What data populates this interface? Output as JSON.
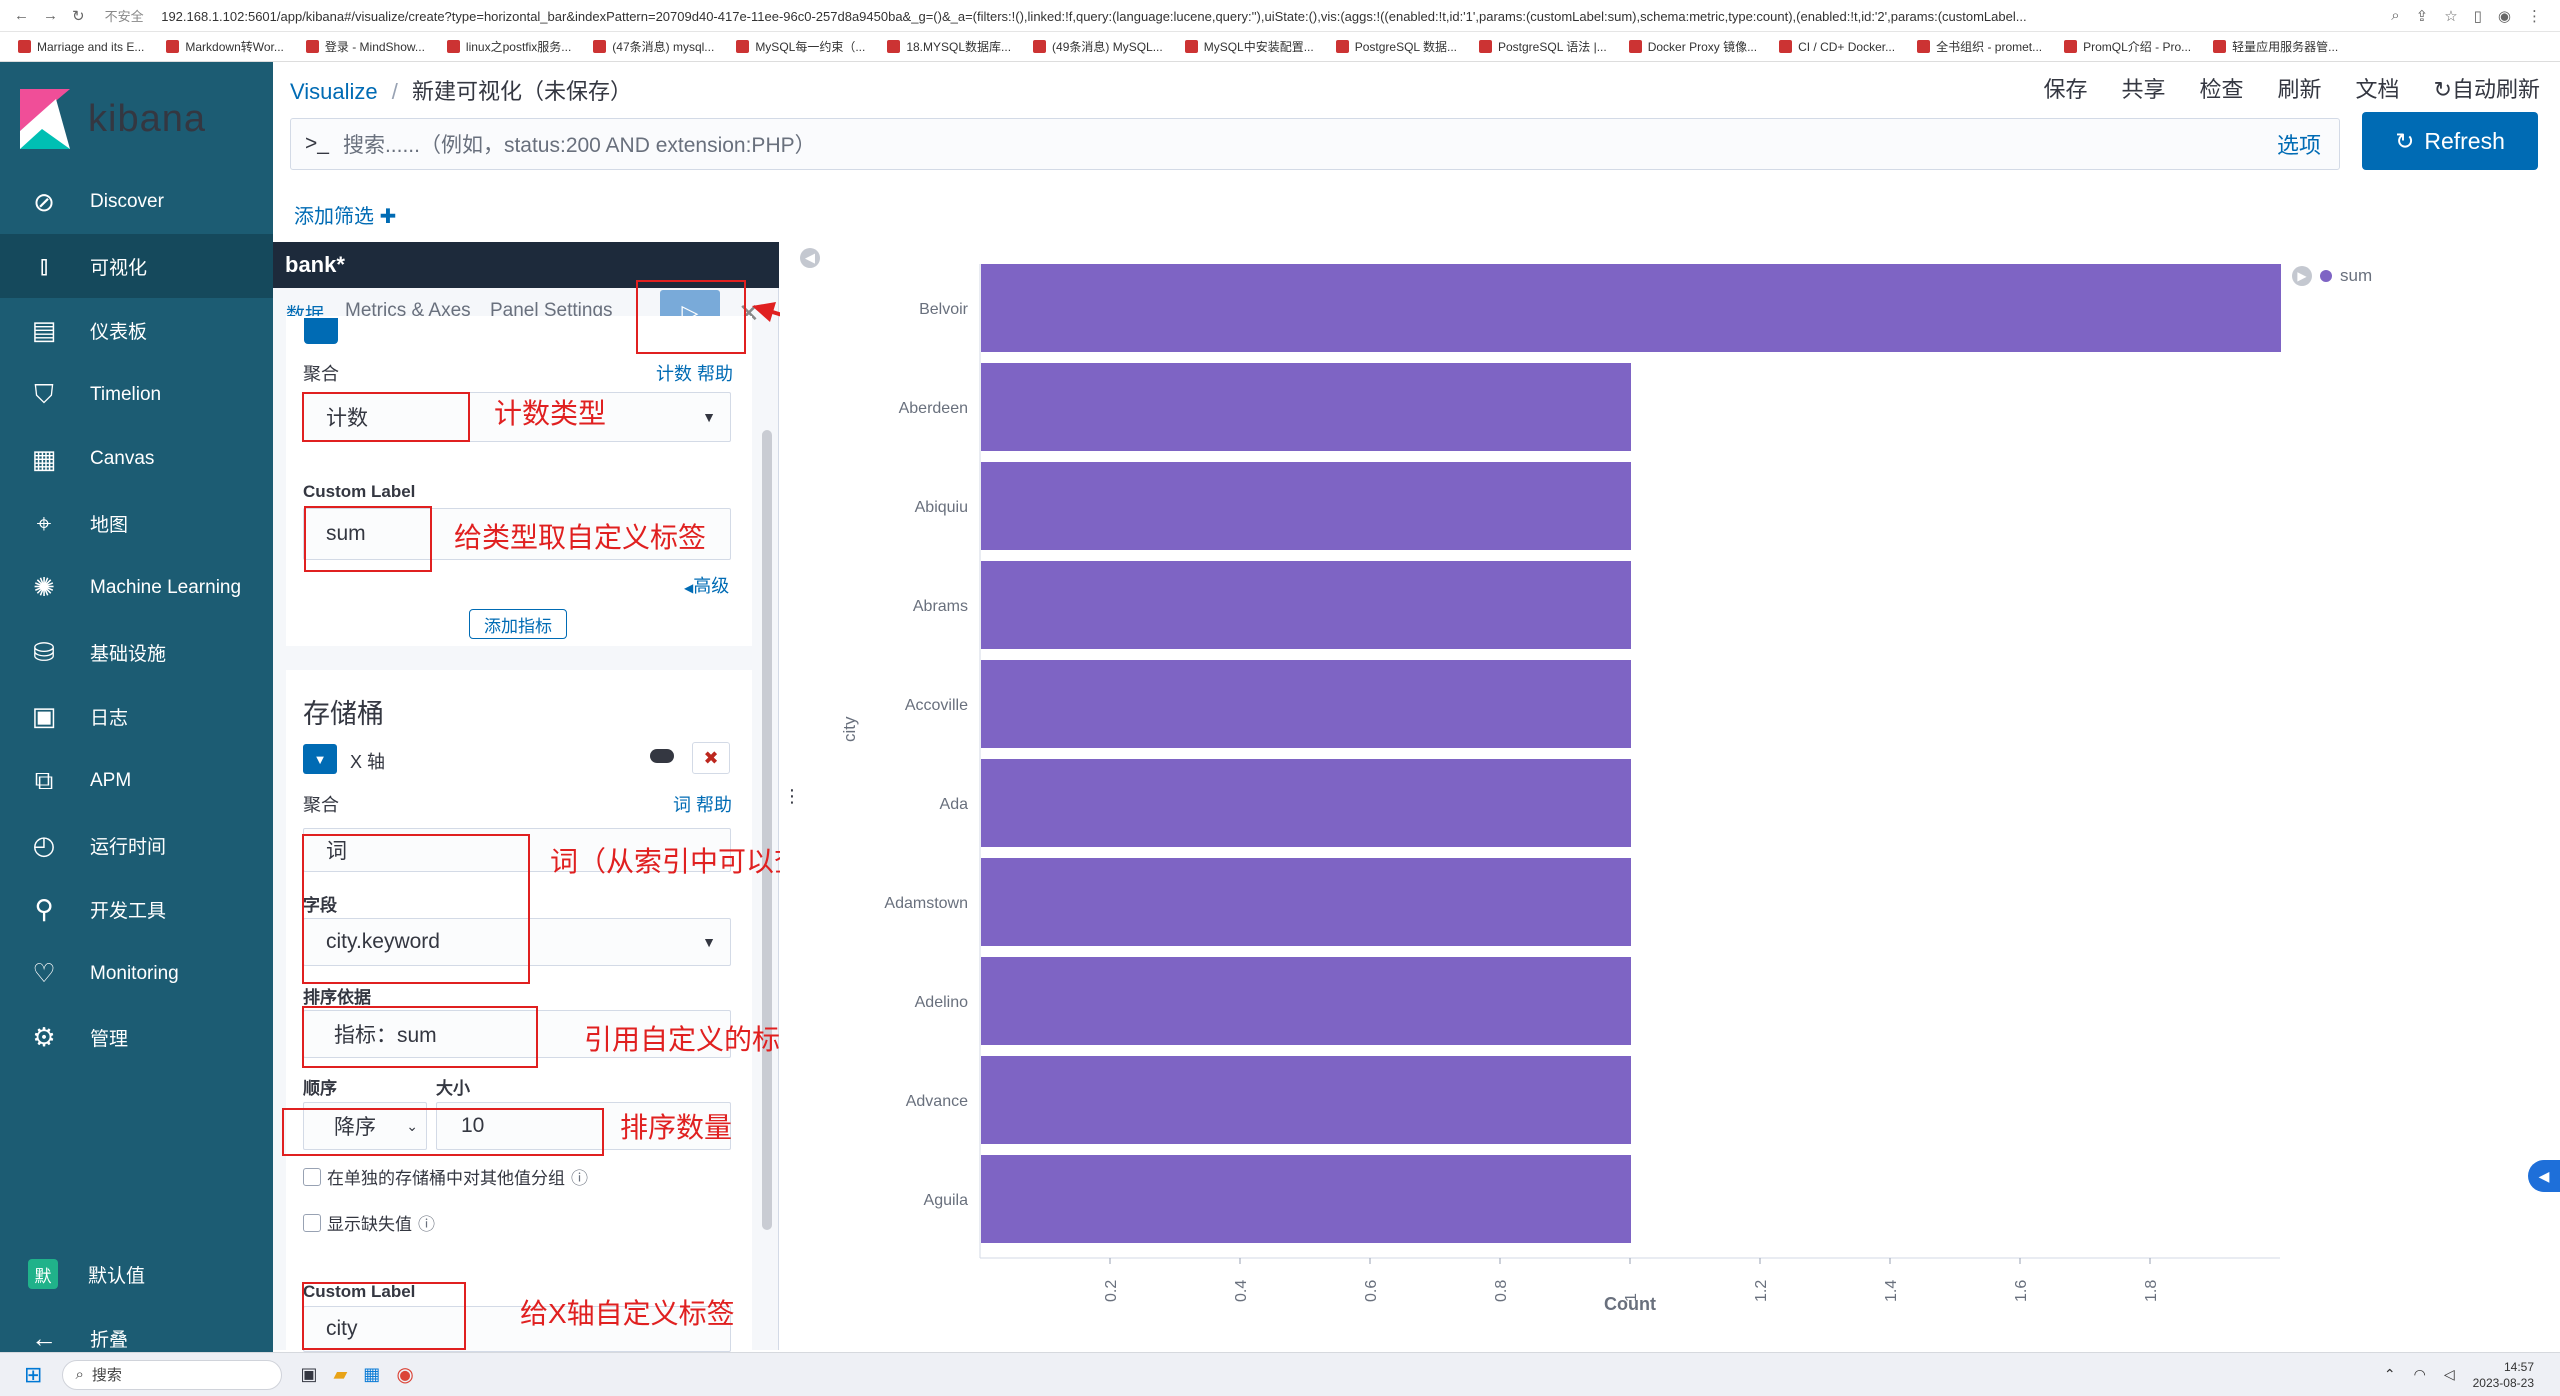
{
  "browser": {
    "insecure_label": "不安全",
    "url": "192.168.1.102:5601/app/kibana#/visualize/create?type=horizontal_bar&indexPattern=20709d40-417e-11ee-96c0-257d8a9450ba&_g=()&_a=(filters:!(),linked:!f,query:(language:lucene,query:''),uiState:(),vis:(aggs:!((enabled:!t,id:'1',params:(customLabel:sum),schema:metric,type:count),(enabled:!t,id:'2',params:(customLabel...",
    "bookmarks": [
      "Marriage and its E...",
      "Markdown转Wor...",
      "登录 - MindShow...",
      "linux之postfix服务...",
      "(47条消息) mysql...",
      "MySQL每一约束（...",
      "18.MYSQL数据库...",
      "(49条消息) MySQL...",
      "MySQL中安装配置...",
      "PostgreSQL 数据...",
      "PostgreSQL 语法 |...",
      "Docker Proxy 镜像...",
      "CI / CD+ Docker...",
      "全书组织 - promet...",
      "PromQL介绍 - Pro...",
      "轻量应用服务器管..."
    ]
  },
  "sidebar": {
    "logo_text": "kibana",
    "items": [
      {
        "label": "Discover",
        "icon": "compass-icon"
      },
      {
        "label": "可视化",
        "icon": "visualize-icon"
      },
      {
        "label": "仪表板",
        "icon": "dashboard-icon"
      },
      {
        "label": "Timelion",
        "icon": "timelion-icon"
      },
      {
        "label": "Canvas",
        "icon": "canvas-icon"
      },
      {
        "label": "地图",
        "icon": "map-icon"
      },
      {
        "label": "Machine Learning",
        "icon": "ml-icon"
      },
      {
        "label": "基础设施",
        "icon": "infrastructure-icon"
      },
      {
        "label": "日志",
        "icon": "logs-icon"
      },
      {
        "label": "APM",
        "icon": "apm-icon"
      },
      {
        "label": "运行时间",
        "icon": "uptime-icon"
      },
      {
        "label": "开发工具",
        "icon": "devtools-icon"
      },
      {
        "label": "Monitoring",
        "icon": "monitoring-icon"
      },
      {
        "label": "管理",
        "icon": "gear-icon"
      }
    ],
    "default_space": {
      "badge": "默",
      "label": "默认值"
    },
    "collapse_label": "折叠"
  },
  "header": {
    "breadcrumb_root": "Visualize",
    "breadcrumb_sep": "/",
    "breadcrumb_current": "新建可视化（未保存）",
    "menu": [
      "保存",
      "共享",
      "检查",
      "刷新",
      "文档"
    ],
    "auto_refresh": "自动刷新",
    "search_prompt": ">_",
    "search_placeholder": "搜索......（例如，status:200 AND extension:PHP）",
    "options_label": "选项",
    "refresh_label": "Refresh",
    "add_filter": "添加筛选"
  },
  "editor": {
    "index_pattern": "bank*",
    "tabs": [
      "数据",
      "Metrics & Axes",
      "Panel Settings"
    ],
    "metrics": {
      "agg_label": "聚合",
      "agg_help": "计数 帮助",
      "agg_value": "计数",
      "custom_label_title": "Custom Label",
      "custom_label_value": "sum",
      "advanced": "高级",
      "add_metric": "添加指标"
    },
    "buckets": {
      "title": "存储桶",
      "axis_label": "X 轴",
      "agg_label": "聚合",
      "agg_help": "词 帮助",
      "agg_value": "词",
      "field_label": "字段",
      "field_value": "city.keyword",
      "order_by_label": "排序依据",
      "order_by_value": "指标：sum",
      "order_label": "顺序",
      "size_label": "大小",
      "order_value": "降序",
      "size_value": "10",
      "group_other": "在单独的存储桶中对其他值分组",
      "show_missing": "显示缺失值",
      "custom_label_title": "Custom Label",
      "custom_label_value": "city"
    }
  },
  "annotations": {
    "apply": "应用",
    "count_type": "计数类型",
    "custom_label": "给类型取自定义标签",
    "terms": "词（从索引中可以查看到的词）",
    "ref_label": "引用自定义的标签类型",
    "sort_count": "排序数量",
    "x_label": "给X轴自定义标签"
  },
  "chart_data": {
    "type": "bar",
    "orientation": "horizontal",
    "categories": [
      "Belvoir",
      "Aberdeen",
      "Abiquiu",
      "Abrams",
      "Accoville",
      "Ada",
      "Adamstown",
      "Adelino",
      "Advance",
      "Aguila"
    ],
    "series": [
      {
        "name": "sum",
        "values": [
          2,
          1,
          1,
          1,
          1,
          1,
          1,
          1,
          1,
          1
        ]
      }
    ],
    "xlabel": "Count",
    "ylabel": "city",
    "xticks": [
      "0.2",
      "0.4",
      "0.6",
      "0.8",
      "1",
      "1.2",
      "1.4",
      "1.6",
      "1.8"
    ],
    "xlim": [
      0,
      2
    ],
    "color": "#7e64c4",
    "legend_position": "top-right"
  },
  "taskbar": {
    "search": "搜索",
    "time": "14:57",
    "date": "2023-08-23"
  }
}
